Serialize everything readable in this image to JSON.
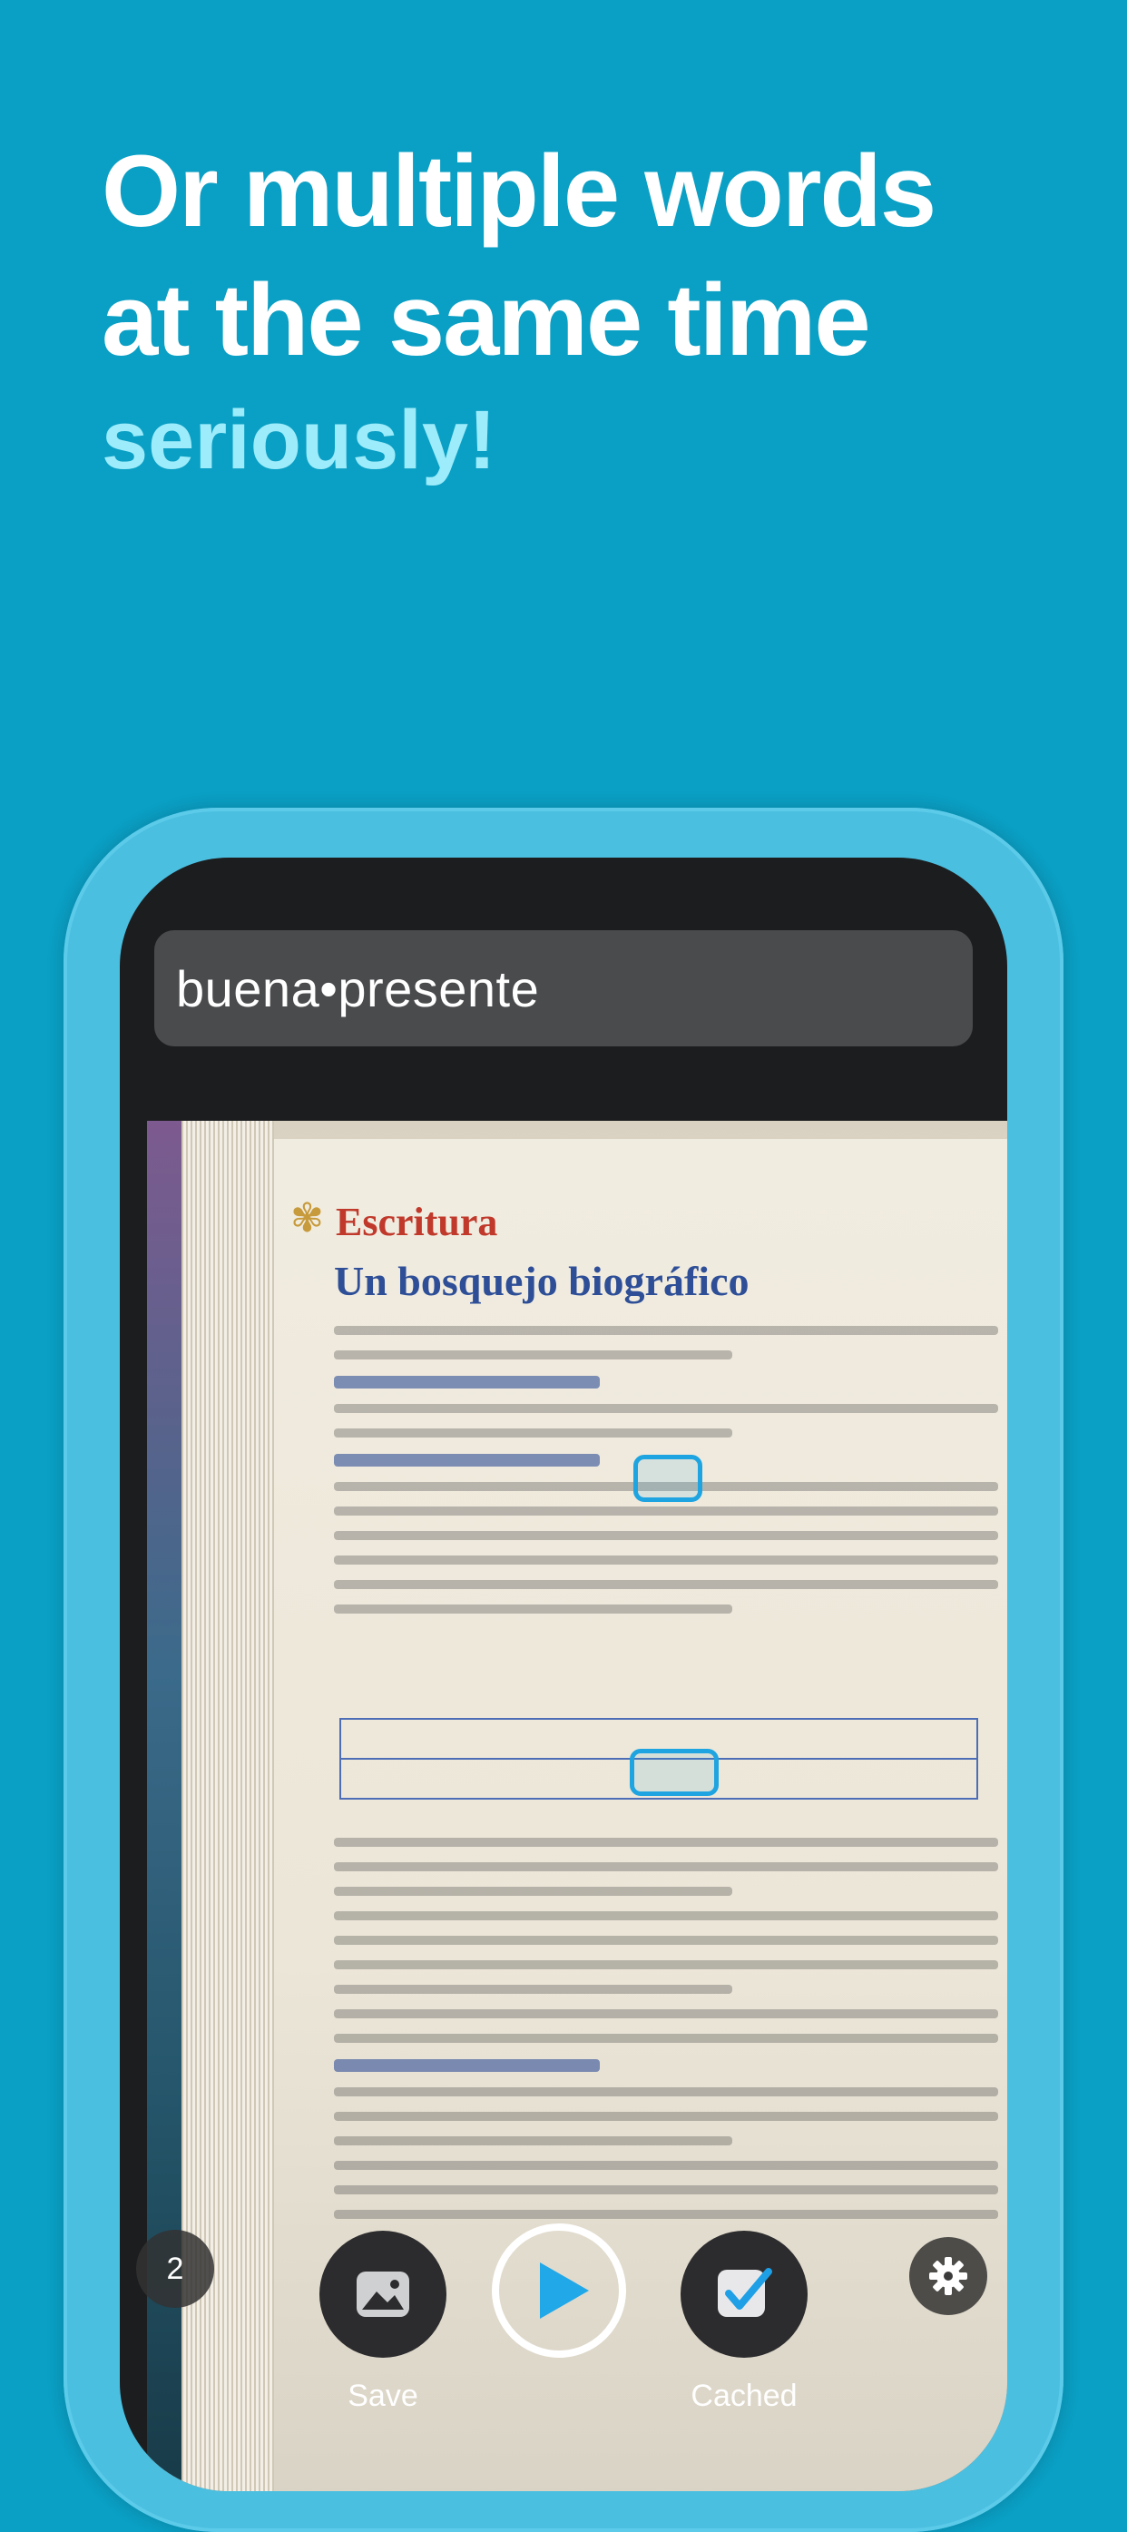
{
  "headline": {
    "line1": "Or multiple words",
    "line2": "at the same time",
    "accent": "seriously!"
  },
  "search": {
    "query": "buena•presente"
  },
  "book": {
    "section": "Escritura",
    "title": "Un bosquejo biográfico"
  },
  "controls": {
    "page_count": "2",
    "save_label": "Save",
    "cached_label": "Cached"
  },
  "icons": {
    "save": "image-icon",
    "play": "play-icon",
    "cached": "checkbox-icon",
    "settings": "gear-icon"
  },
  "colors": {
    "background": "#0a9fc4",
    "accent_text": "#9cecfb",
    "highlight": "#1ea4e0",
    "play": "#20a8e8"
  }
}
